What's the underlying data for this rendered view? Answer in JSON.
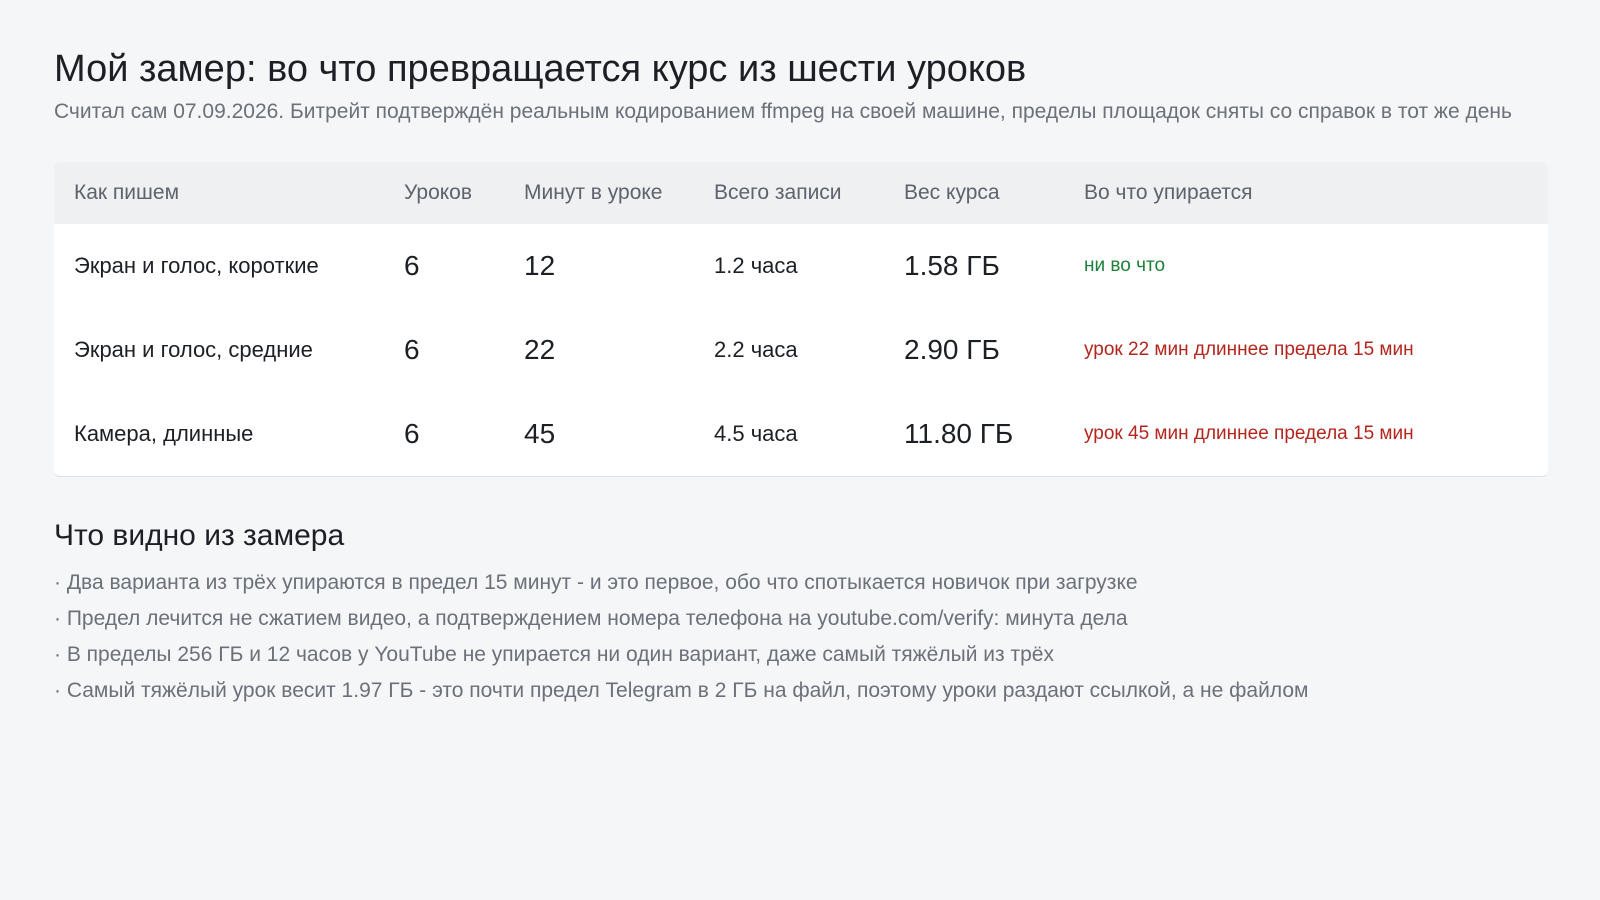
{
  "header": {
    "title": "Мой замер: во что превращается курс из шести уроков",
    "subtitle": "Считал сам 07.09.2026. Битрейт подтверждён реальным кодированием ffmpeg на своей машине, пределы площадок сняты со справок в тот же день"
  },
  "table": {
    "columns": [
      "Как пишем",
      "Уроков",
      "Минут в уроке",
      "Всего записи",
      "Вес курса",
      "Во что упирается"
    ],
    "rows": [
      {
        "method": "Экран и голос, короткие",
        "lessons": "6",
        "minutes": "12",
        "total": "1.2 часа",
        "size": "1.58 ГБ",
        "limit": "ни во что",
        "status": "ok"
      },
      {
        "method": "Экран и голос, средние",
        "lessons": "6",
        "minutes": "22",
        "total": "2.2 часа",
        "size": "2.90 ГБ",
        "limit": "урок 22 мин длиннее предела 15 мин",
        "status": "bad"
      },
      {
        "method": "Камера, длинные",
        "lessons": "6",
        "minutes": "45",
        "total": "4.5 часа",
        "size": "11.80 ГБ",
        "limit": "урок 45 мин длиннее предела 15 мин",
        "status": "bad"
      }
    ]
  },
  "findings": {
    "title": "Что видно из замера",
    "items": [
      "· Два варианта из трёх упираются в предел 15 минут - и это первое, обо что спотыкается новичок при загрузке",
      "· Предел лечится не сжатием видео, а подтверждением номера телефона на youtube.com/verify: минута дела",
      "· В пределы 256 ГБ и 12 часов у YouTube не упирается ни один вариант, даже самый тяжёлый из трёх",
      "· Самый тяжёлый урок весит 1.97 ГБ - это почти предел Telegram в 2 ГБ на файл, поэтому уроки раздают ссылкой, а не файлом"
    ]
  },
  "colors": {
    "ok": "#1e7f3a",
    "bad": "#b3261e"
  }
}
